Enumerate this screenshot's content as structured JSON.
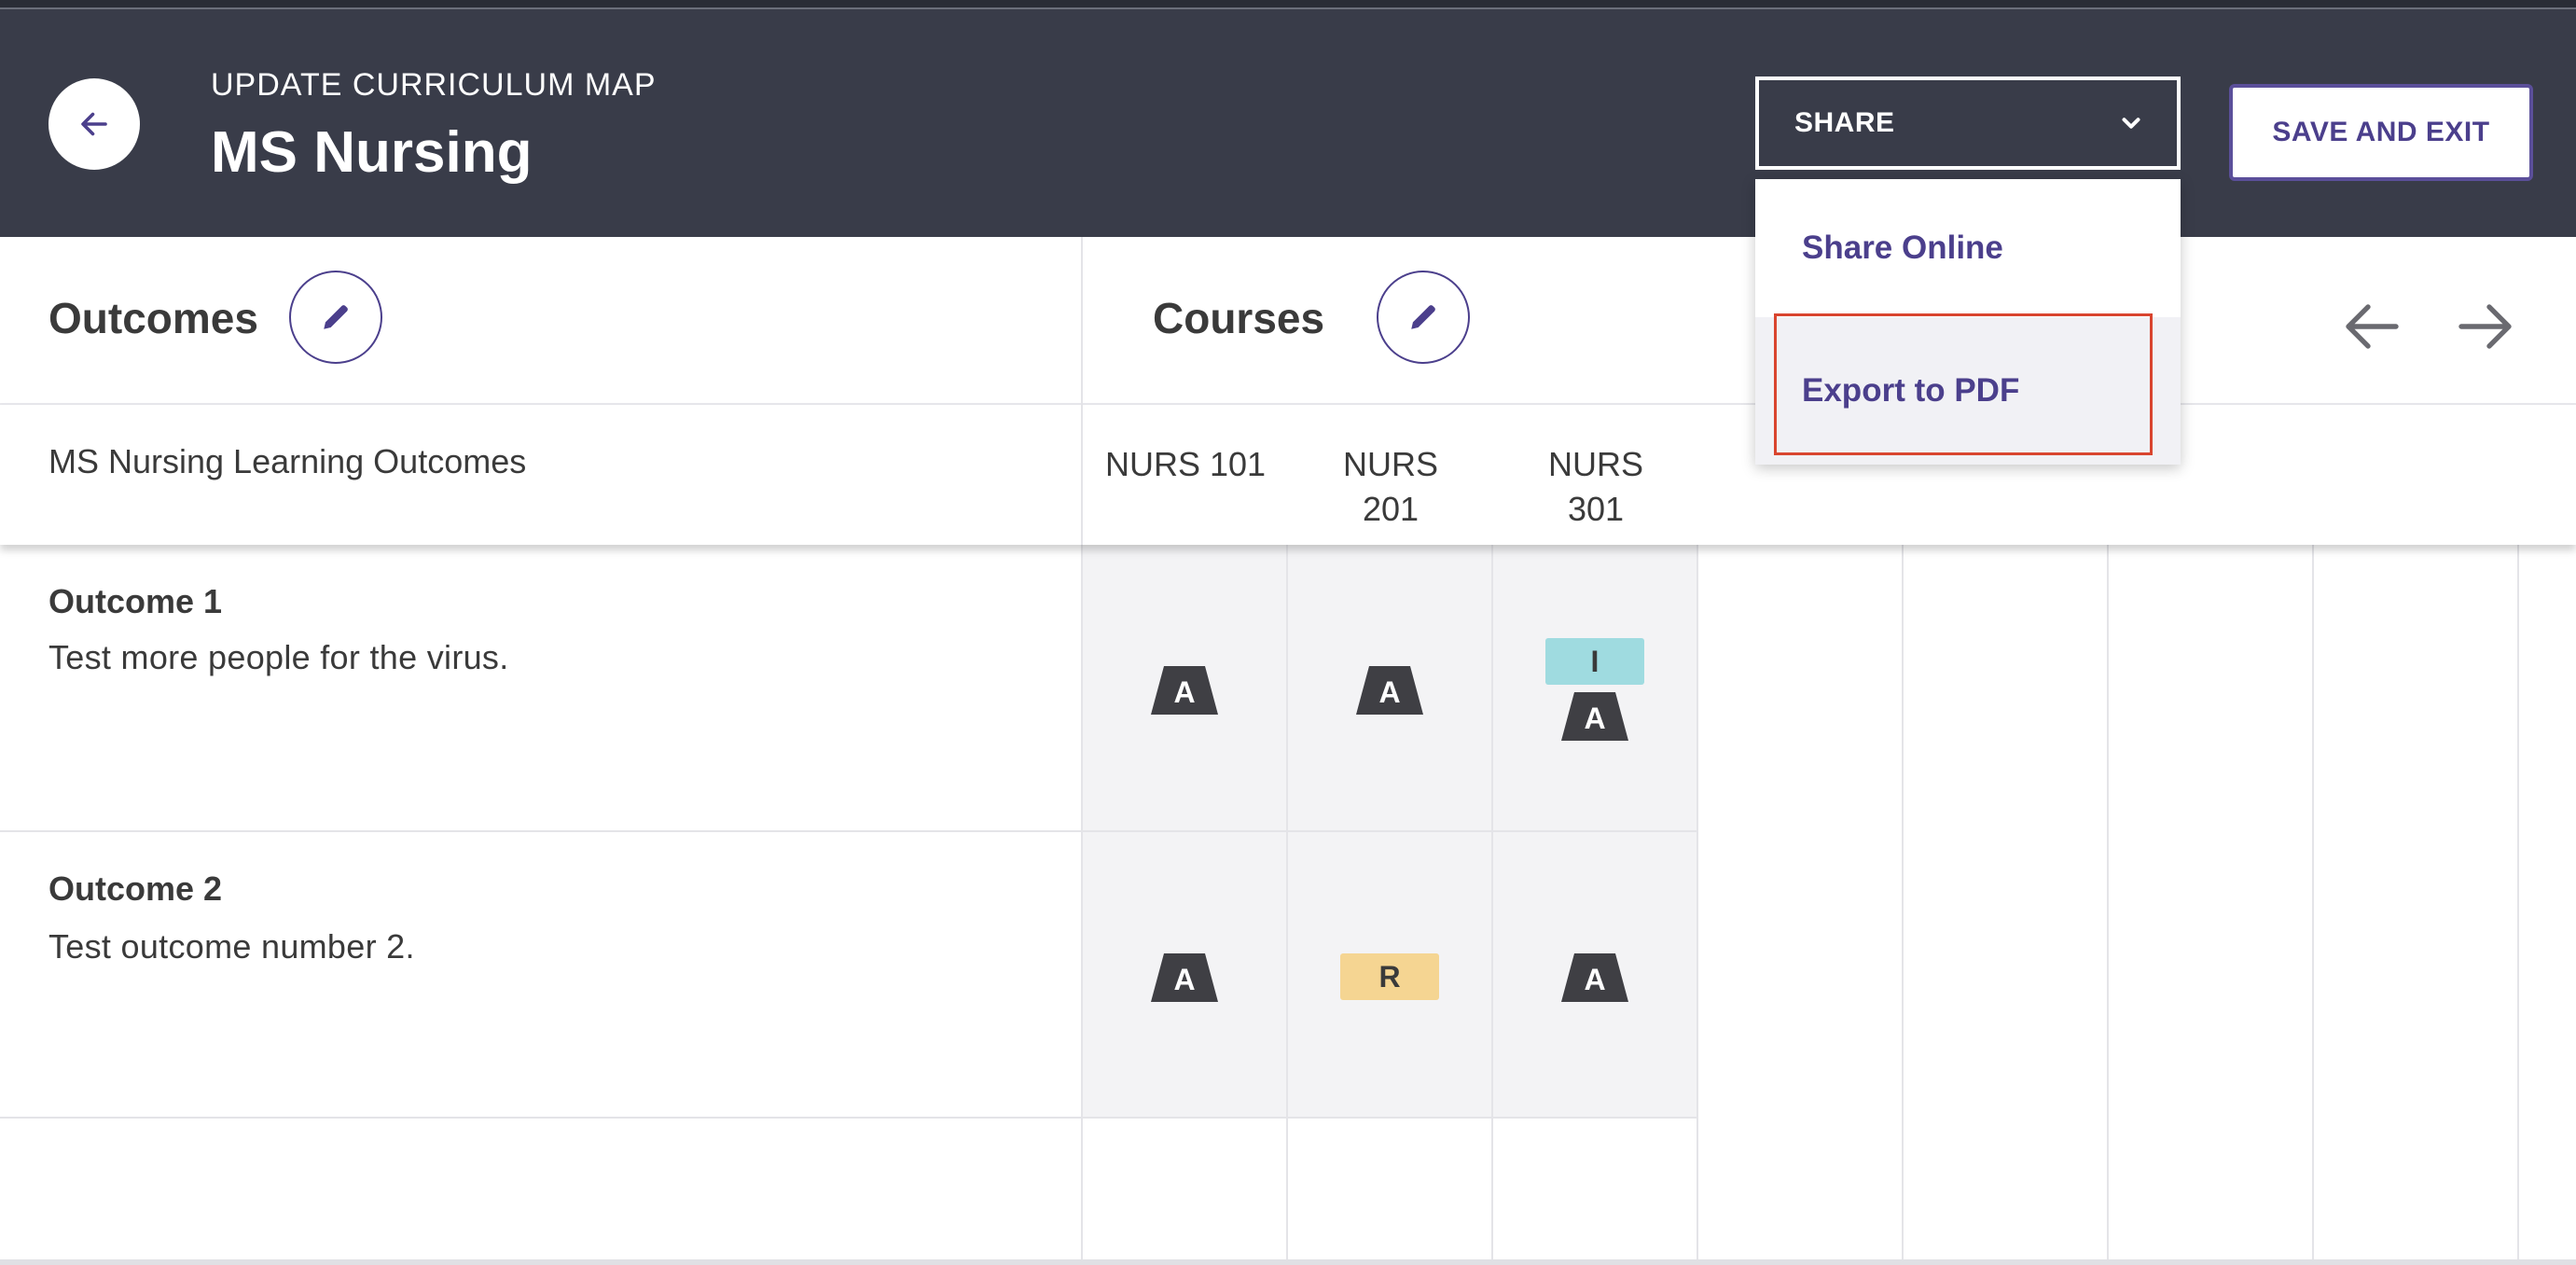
{
  "header": {
    "eyebrow": "UPDATE CURRICULUM MAP",
    "title": "MS Nursing",
    "share_label": "SHARE",
    "save_label": "SAVE AND EXIT"
  },
  "share_menu": {
    "items": [
      {
        "label": "Share Online"
      },
      {
        "label": "Export to PDF"
      }
    ]
  },
  "toolbar": {
    "outcomes_label": "Outcomes",
    "courses_label": "Courses"
  },
  "table": {
    "outcomes_header": "MS Nursing Learning Outcomes",
    "courses": [
      {
        "line1": "NURS 101",
        "line2": ""
      },
      {
        "line1": "NURS",
        "line2": "201"
      },
      {
        "line1": "NURS",
        "line2": "301"
      }
    ],
    "rows": [
      {
        "title": "Outcome 1",
        "description": "Test more people for the virus.",
        "cells": [
          [
            "A"
          ],
          [
            "A"
          ],
          [
            "I",
            "A"
          ]
        ]
      },
      {
        "title": "Outcome 2",
        "description": "Test outcome number 2.",
        "cells": [
          [
            "A"
          ],
          [
            "R"
          ],
          [
            "A"
          ]
        ]
      }
    ]
  },
  "colors": {
    "header_bg": "#393c49",
    "accent": "#4b3f8c",
    "badge_A": "#3f3f44",
    "badge_I": "#9fdbe0",
    "badge_R": "#f5d592",
    "highlight": "#d9452f"
  }
}
